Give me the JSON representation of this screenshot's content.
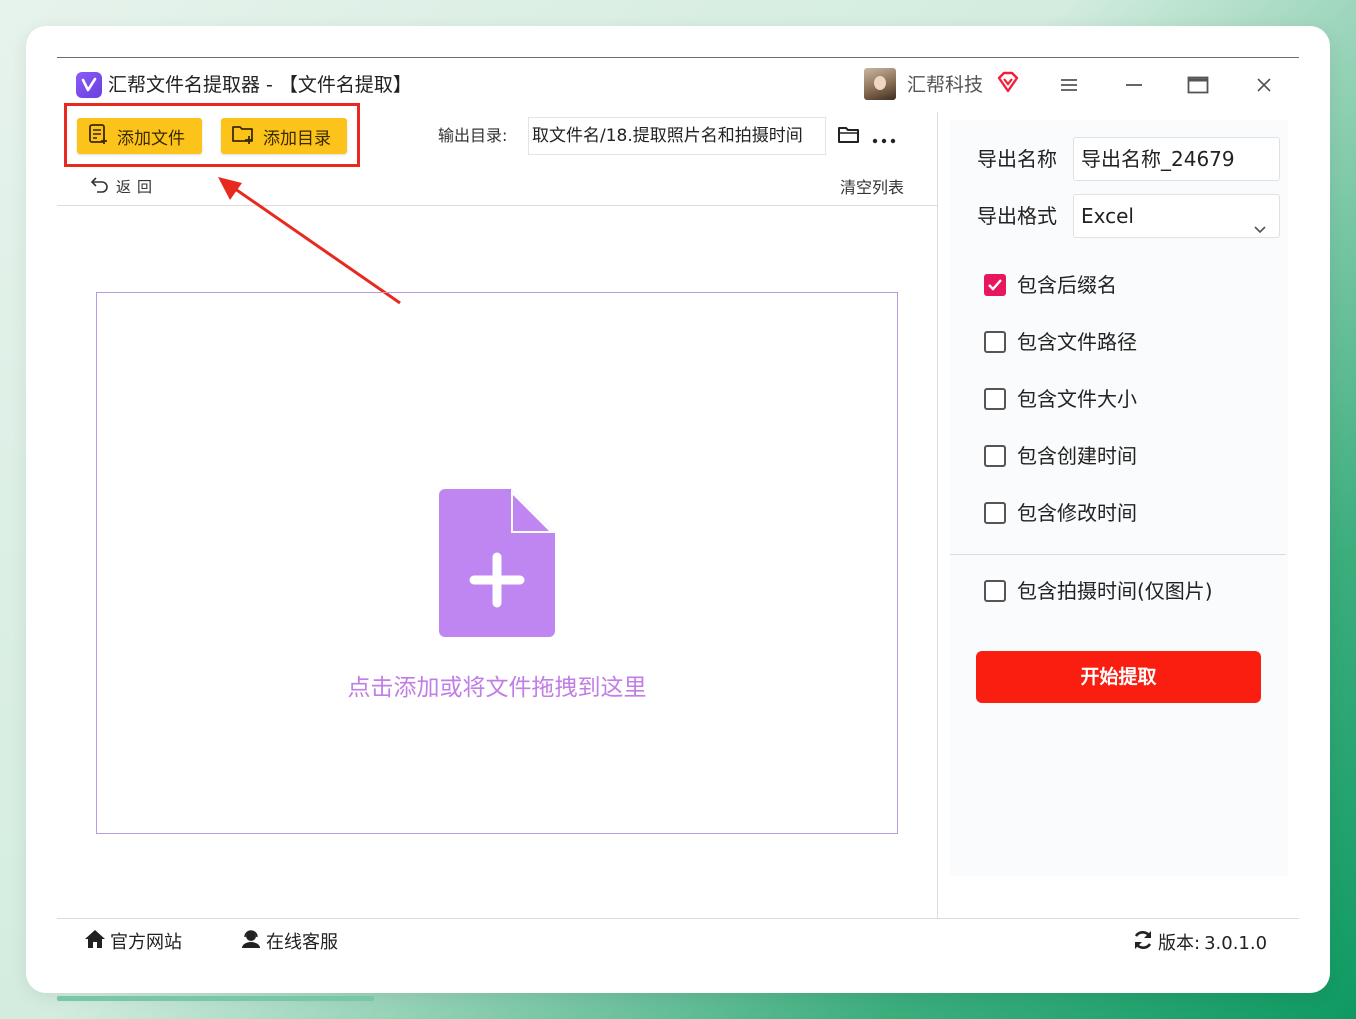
{
  "window": {
    "title": "汇帮文件名提取器 - 【文件名提取】",
    "brand": "汇帮科技"
  },
  "toolbar": {
    "add_file_label": "添加文件",
    "add_dir_label": "添加目录",
    "output_dir_label": "输出目录:",
    "output_dir_value": "取文件名/18.提取照片名和拍摄时间",
    "back_label": "返回",
    "clear_list_label": "清空列表"
  },
  "dropzone": {
    "hint": "点击添加或将文件拖拽到这里"
  },
  "settings": {
    "export_name_label": "导出名称",
    "export_name_value": "导出名称_24679",
    "export_format_label": "导出格式",
    "export_format_value": "Excel",
    "options": [
      {
        "label": "包含后缀名",
        "checked": true
      },
      {
        "label": "包含文件路径",
        "checked": false
      },
      {
        "label": "包含文件大小",
        "checked": false
      },
      {
        "label": "包含创建时间",
        "checked": false
      },
      {
        "label": "包含修改时间",
        "checked": false
      }
    ],
    "photo_option": {
      "label": "包含拍摄时间(仅图片)",
      "checked": false
    },
    "start_label": "开始提取"
  },
  "footer": {
    "website_label": "官方网站",
    "support_label": "在线客服",
    "version_label": "版本:",
    "version_value": "3.0.1.0"
  },
  "colors": {
    "add_button": "#fcc41a",
    "start_button": "#fa1e10",
    "checkbox_on": "#e8175d",
    "drop_hint": "#c07ee6",
    "file_icon": "#bf86f2",
    "highlight_box": "#e8291f"
  }
}
